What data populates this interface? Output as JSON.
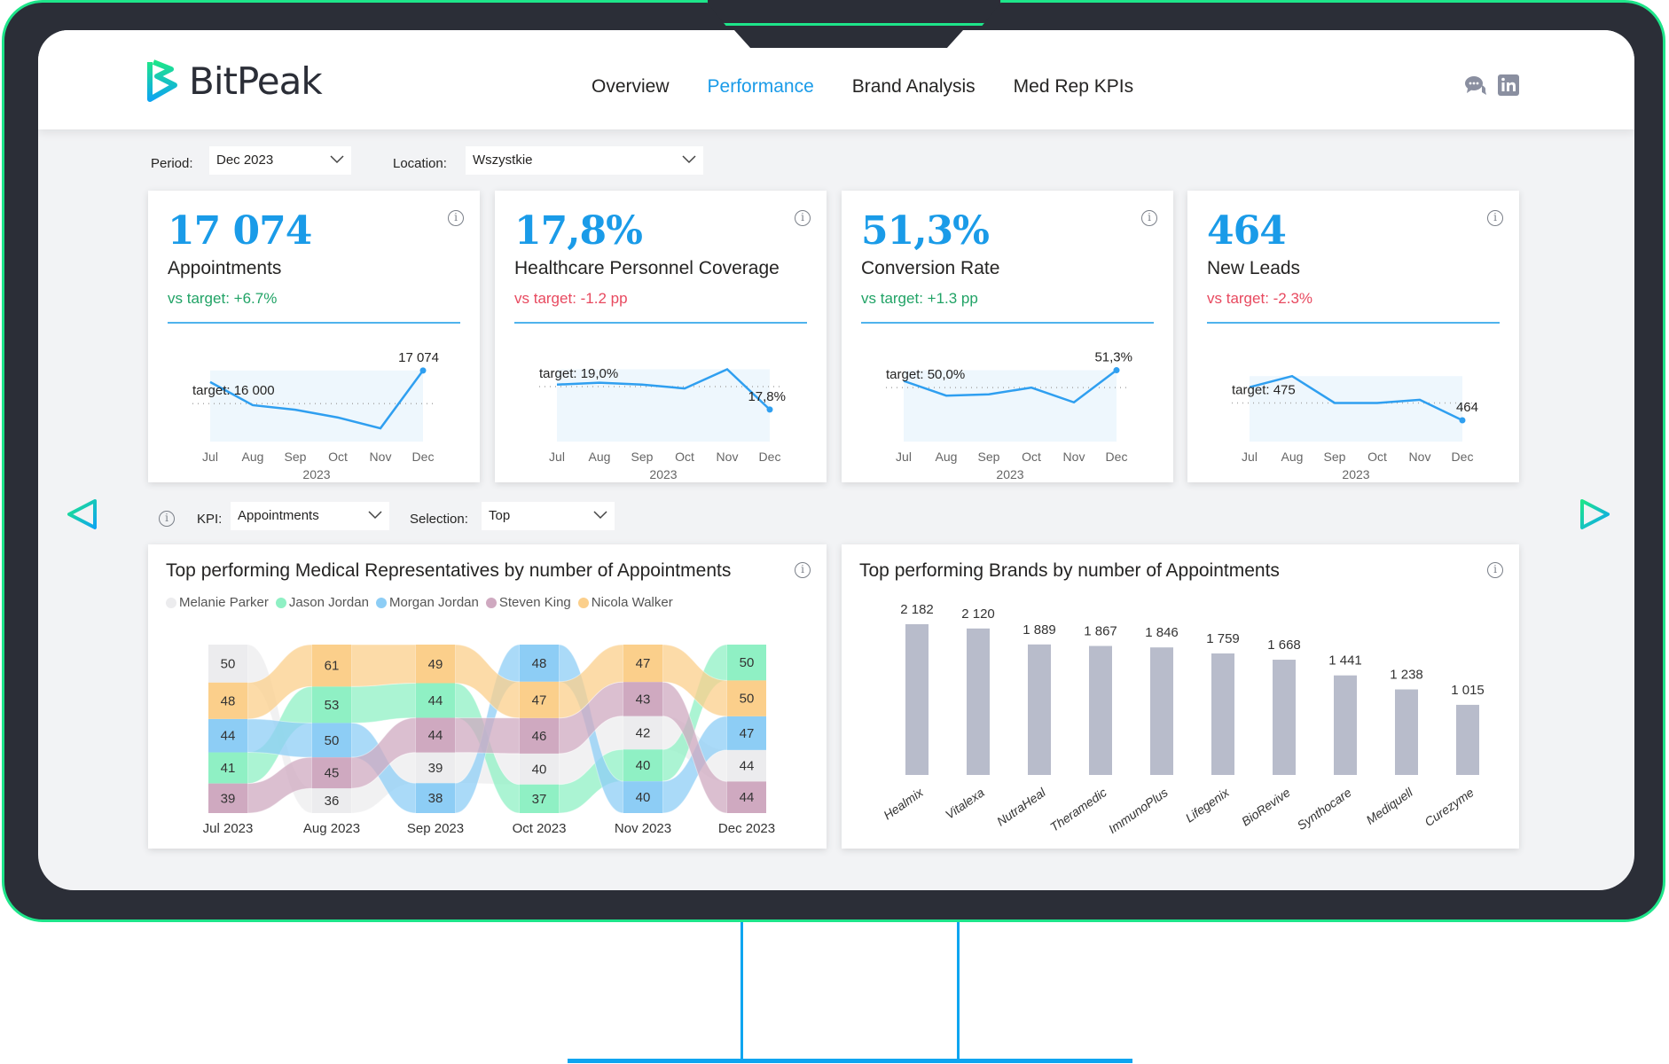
{
  "brand": {
    "name": "BitPeak",
    "accent": "#1a9be8",
    "green": "#1ee58a"
  },
  "nav": {
    "items": [
      {
        "label": "Overview",
        "active": false
      },
      {
        "label": "Performance",
        "active": true
      },
      {
        "label": "Brand Analysis",
        "active": false
      },
      {
        "label": "Med Rep KPIs",
        "active": false
      }
    ]
  },
  "header_icons": [
    "chat-icon",
    "linkedin-icon"
  ],
  "filters": {
    "period_label": "Period:",
    "period_value": "Dec 2023",
    "location_label": "Location:",
    "location_value": "Wszystkie",
    "kpi_label": "KPI:",
    "kpi_value": "Appointments",
    "selection_label": "Selection:",
    "selection_value": "Top"
  },
  "kpis": [
    {
      "value": "17 074",
      "label": "Appointments",
      "delta": "vs target: +6.7%",
      "delta_color": "#21a366",
      "spark": {
        "months": [
          "Jul",
          "Aug",
          "Sep",
          "Oct",
          "Nov",
          "Dec"
        ],
        "year": "2023",
        "values": [
          16700,
          15950,
          15800,
          15550,
          15200,
          17074
        ],
        "target": 16000,
        "target_label": "target: 16 000",
        "last_label": "17 074",
        "ylim": [
          15000,
          17300
        ]
      }
    },
    {
      "value": "17,8%",
      "label": "Healthcare Personnel Coverage",
      "delta": "vs target: -1.2 pp",
      "delta_color": "#e8495f",
      "spark": {
        "months": [
          "Jul",
          "Aug",
          "Sep",
          "Oct",
          "Nov",
          "Dec"
        ],
        "year": "2023",
        "values": [
          19.1,
          19.2,
          19.1,
          18.9,
          19.9,
          17.8
        ],
        "target": 19.0,
        "target_label": "target: 19,0%",
        "last_label": "17,8%",
        "ylim": [
          16.5,
          20.2
        ]
      }
    },
    {
      "value": "51,3%",
      "label": "Conversion Rate",
      "delta": "vs target: +1.3 pp",
      "delta_color": "#21a366",
      "spark": {
        "months": [
          "Jul",
          "Aug",
          "Sep",
          "Oct",
          "Nov",
          "Dec"
        ],
        "year": "2023",
        "values": [
          50.5,
          49.4,
          49.5,
          50.0,
          48.9,
          51.3
        ],
        "target": 50.0,
        "target_label": "target: 50,0%",
        "last_label": "51,3%",
        "ylim": [
          46.5,
          51.8
        ]
      }
    },
    {
      "value": "464",
      "label": "New Leads",
      "delta": "vs target: -2.3%",
      "delta_color": "#e8495f",
      "spark": {
        "months": [
          "Jul",
          "Aug",
          "Sep",
          "Oct",
          "Nov",
          "Dec"
        ],
        "year": "2023",
        "values": [
          485,
          492,
          475,
          475,
          477,
          464
        ],
        "target": 475,
        "target_label": "target: 475",
        "last_label": "464",
        "ylim": [
          455,
          500
        ]
      }
    }
  ],
  "chart_data": [
    {
      "type": "ribbon",
      "title": "Top performing Medical Representatives by number of Appointments",
      "categories": [
        "Jul 2023",
        "Aug 2023",
        "Sep 2023",
        "Oct 2023",
        "Nov 2023",
        "Dec 2023"
      ],
      "series": [
        {
          "name": "Melanie Parker",
          "color": "#ececee",
          "values": [
            50,
            36,
            39,
            40,
            42,
            44
          ]
        },
        {
          "name": "Jason Jordan",
          "color": "#8ff0c4",
          "values": [
            41,
            53,
            44,
            37,
            40,
            50
          ]
        },
        {
          "name": "Morgan Jordan",
          "color": "#8dcdf5",
          "values": [
            44,
            50,
            38,
            48,
            40,
            47
          ]
        },
        {
          "name": "Steven King",
          "color": "#cfa9c0",
          "values": [
            39,
            45,
            44,
            46,
            43,
            44
          ]
        },
        {
          "name": "Nicola Walker",
          "color": "#fbcf8b",
          "values": [
            48,
            61,
            49,
            47,
            47,
            50
          ]
        }
      ]
    },
    {
      "type": "bar",
      "title": "Top performing Brands by number of Appointments",
      "categories": [
        "Healmix",
        "Vitalexa",
        "NutraHeal",
        "Theramedic",
        "ImmunoPlus",
        "Lifegenix",
        "BioRevive",
        "Synthocare",
        "Mediquell",
        "Curezyme"
      ],
      "values": [
        2182,
        2120,
        1889,
        1867,
        1846,
        1759,
        1668,
        1441,
        1238,
        1015
      ],
      "labels": [
        "2 182",
        "2 120",
        "1 889",
        "1 867",
        "1 846",
        "1 759",
        "1 668",
        "1 441",
        "1 238",
        "1 015"
      ],
      "bar_color": "#b8bccb",
      "ylim": [
        0,
        2400
      ]
    }
  ]
}
